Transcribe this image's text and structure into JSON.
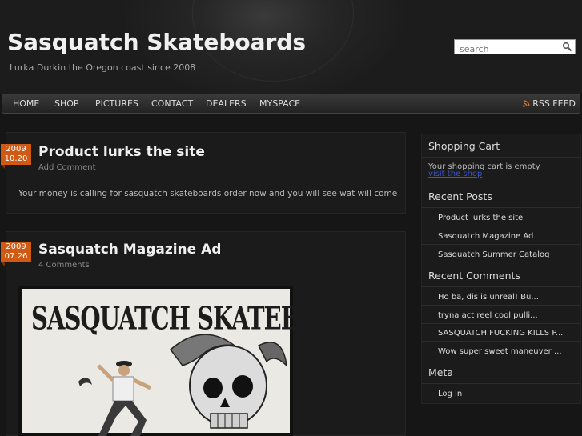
{
  "site": {
    "title": "Sasquatch Skateboards",
    "description": "Lurka Durkin the Oregon coast since 2008"
  },
  "search": {
    "placeholder": "search",
    "value": ""
  },
  "nav": {
    "items": [
      "HOME",
      "SHOP",
      "PICTURES",
      "CONTACT",
      "DEALERS",
      "MYSPACE"
    ],
    "rss_label": "RSS FEED"
  },
  "posts": [
    {
      "date_year": "2009",
      "date_day": "10.20",
      "title": "Product lurks the site",
      "meta": "Add Comment",
      "body": "Your money is calling for sasquatch skateboards order now and you will see wat will come"
    },
    {
      "date_year": "2009",
      "date_day": "07.26",
      "title": "Sasquatch Magazine Ad",
      "meta": "4 Comments",
      "image_text": "SASQUATCH SKATEBOARDS"
    }
  ],
  "sidebar": {
    "cart": {
      "title": "Shopping Cart",
      "text": "Your shopping cart is empty",
      "link": "visit the shop"
    },
    "recent_posts": {
      "title": "Recent Posts",
      "items": [
        "Product lurks the site",
        "Sasquatch Magazine Ad",
        "Sasquatch Summer Catalog"
      ]
    },
    "recent_comments": {
      "title": "Recent Comments",
      "items": [
        "Ho ba, dis is unreal! Bu...",
        "tryna act reel cool pulli...",
        "SASQUATCH FUCKING KILLS P...",
        "Wow super sweet maneuver ..."
      ]
    },
    "meta": {
      "title": "Meta",
      "items": [
        "Log in"
      ]
    }
  },
  "colors": {
    "accent": "#d05a14",
    "rss": "#e8731e",
    "link": "#3b54c7"
  }
}
